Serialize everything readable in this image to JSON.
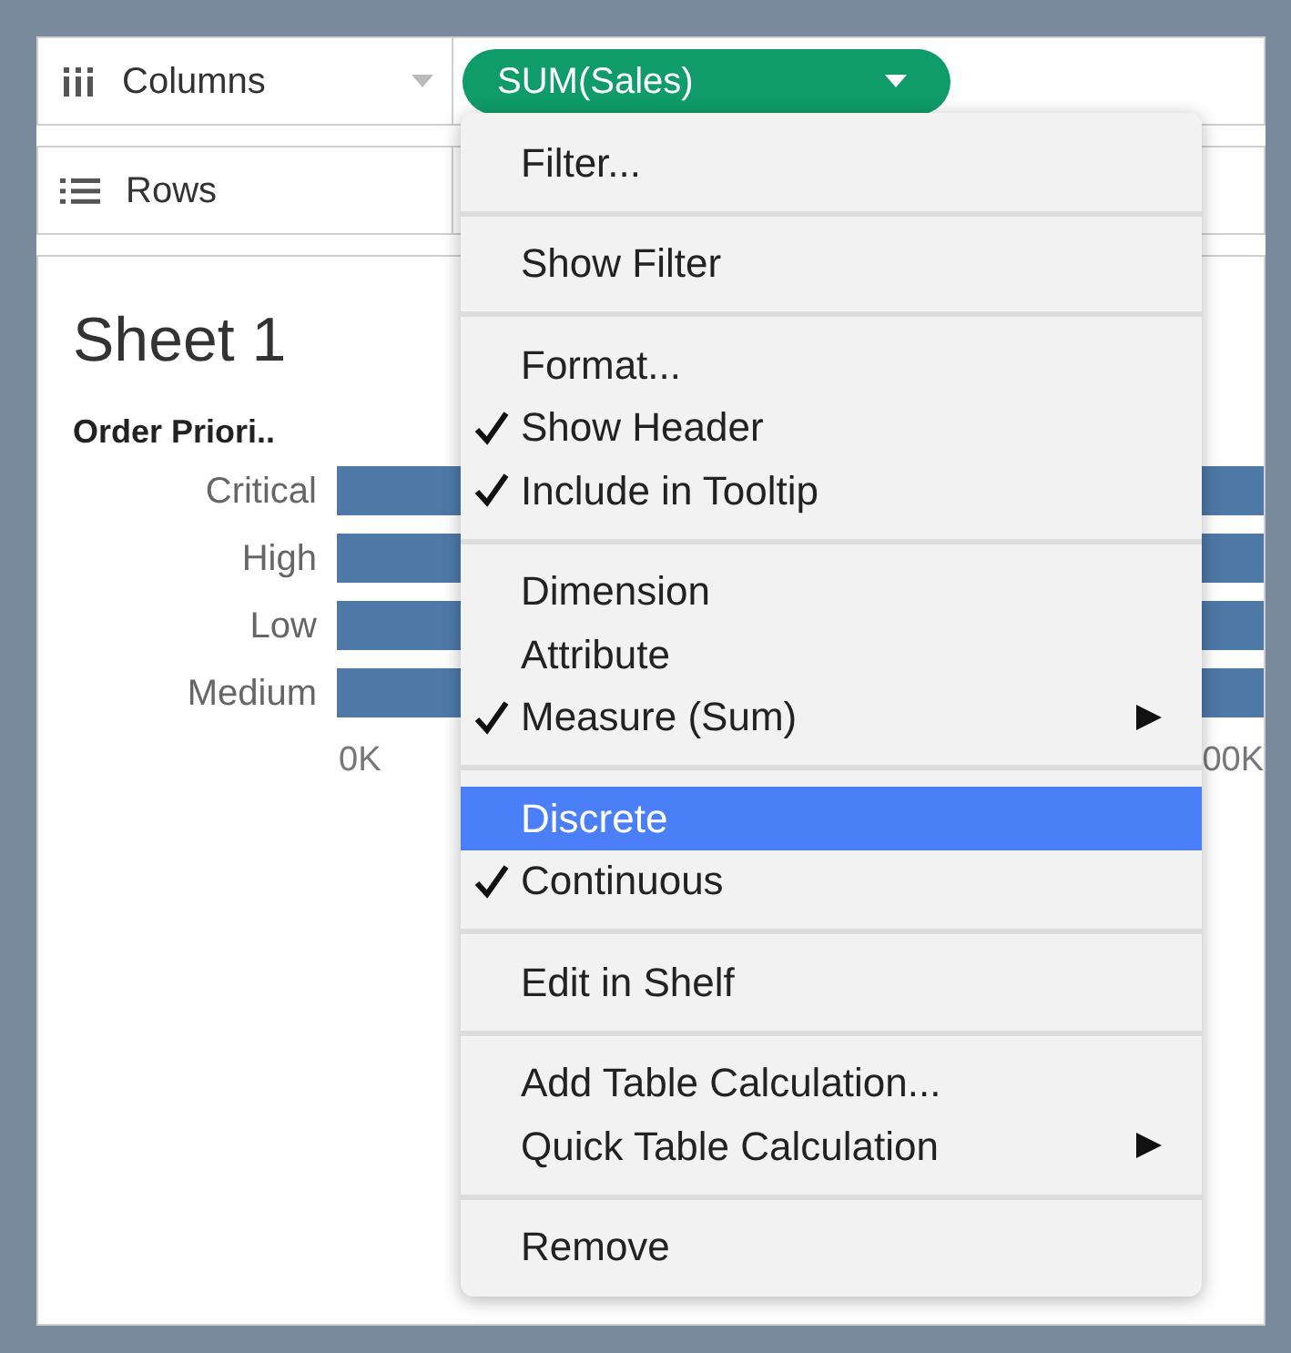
{
  "shelves": [
    {
      "kind": "columns",
      "label": "Columns",
      "pill": "SUM(Sales)"
    },
    {
      "kind": "rows",
      "label": "Rows"
    }
  ],
  "sheet": {
    "title": "Sheet 1",
    "header": "Order Priori..",
    "rows": [
      {
        "label": "Critical"
      },
      {
        "label": "High"
      },
      {
        "label": "Low"
      },
      {
        "label": "Medium"
      }
    ],
    "axis_ticks": [
      "0K",
      "00K"
    ]
  },
  "menu": [
    [
      {
        "label": "Filter...",
        "checked": false,
        "selected": false,
        "submenu": false
      }
    ],
    [
      {
        "label": "Show Filter",
        "checked": false,
        "selected": false,
        "submenu": false
      }
    ],
    [
      {
        "label": "Format...",
        "checked": false,
        "selected": false,
        "submenu": false
      },
      {
        "label": "Show Header",
        "checked": true,
        "selected": false,
        "submenu": false
      },
      {
        "label": "Include in Tooltip",
        "checked": true,
        "selected": false,
        "submenu": false
      }
    ],
    [
      {
        "label": "Dimension",
        "checked": false,
        "selected": false,
        "submenu": false
      },
      {
        "label": "Attribute",
        "checked": false,
        "selected": false,
        "submenu": false
      },
      {
        "label": "Measure (Sum)",
        "checked": true,
        "selected": false,
        "submenu": true
      }
    ],
    [
      {
        "label": "Discrete",
        "checked": false,
        "selected": true,
        "submenu": false
      },
      {
        "label": "Continuous",
        "checked": true,
        "selected": false,
        "submenu": false
      }
    ],
    [
      {
        "label": "Edit in Shelf",
        "checked": false,
        "selected": false,
        "submenu": false
      }
    ],
    [
      {
        "label": "Add Table Calculation...",
        "checked": false,
        "selected": false,
        "submenu": false
      },
      {
        "label": "Quick Table Calculation",
        "checked": false,
        "selected": false,
        "submenu": true
      }
    ],
    [
      {
        "label": "Remove",
        "checked": false,
        "selected": false,
        "submenu": false
      }
    ]
  ]
}
